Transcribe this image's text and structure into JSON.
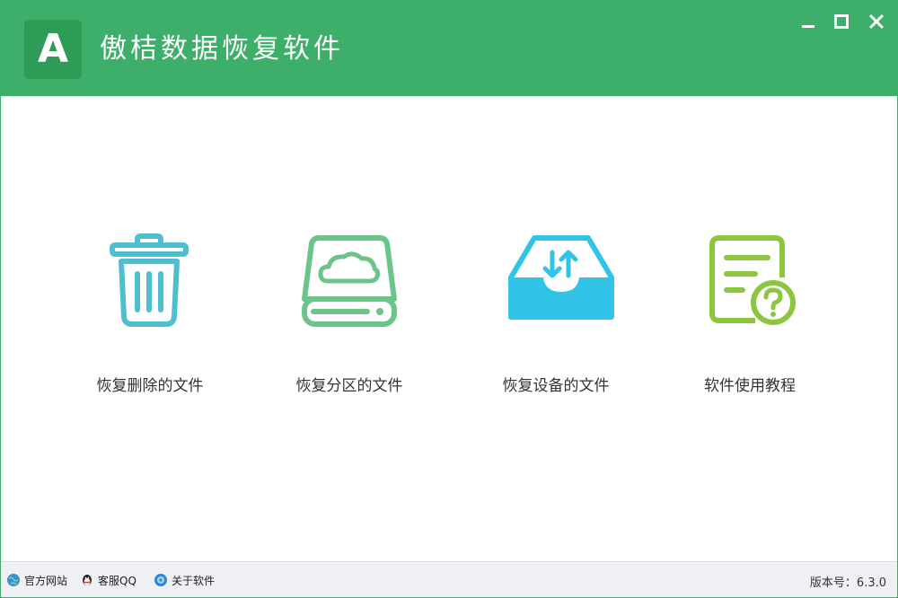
{
  "app": {
    "logo_letter": "A",
    "title": "傲桔数据恢复软件"
  },
  "window_controls": {
    "icons": [
      "minimize-icon",
      "maximize-icon",
      "close-icon"
    ]
  },
  "tiles": [
    {
      "label": "恢复删除的文件",
      "icon": "trash-icon",
      "color": "#4fbfcf"
    },
    {
      "label": "恢复分区的文件",
      "icon": "drive-cloud-icon",
      "color": "#6cc489"
    },
    {
      "label": "恢复设备的文件",
      "icon": "inbox-transfer-icon",
      "color": "#2fc4e8"
    },
    {
      "label": "软件使用教程",
      "icon": "document-help-icon",
      "color": "#8cc63f"
    }
  ],
  "statusbar": {
    "links": [
      {
        "label": "官方网站",
        "icon": "globe-icon"
      },
      {
        "label": "客服QQ",
        "icon": "qq-penguin-icon"
      },
      {
        "label": "关于软件",
        "icon": "info-globe-icon"
      }
    ],
    "version": "版本号：6.3.0"
  },
  "colors": {
    "brand": "#3daf6a",
    "brand_dark": "#2e9b57"
  }
}
